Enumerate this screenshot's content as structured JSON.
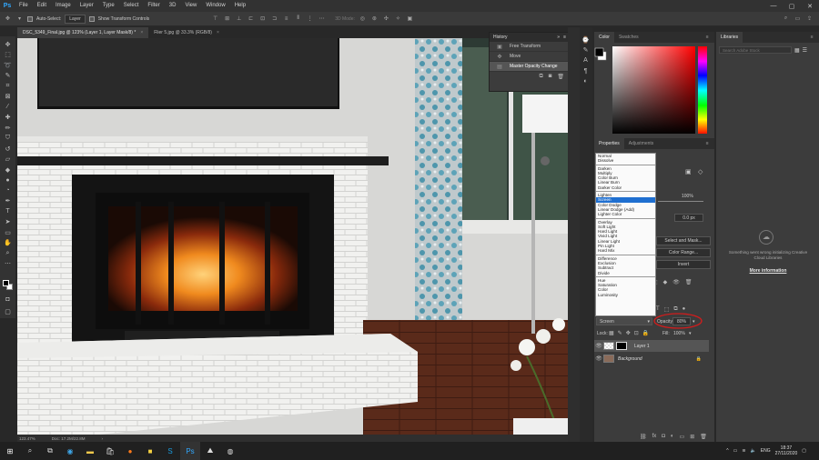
{
  "app": {
    "logo": "Ps"
  },
  "menu": [
    "File",
    "Edit",
    "Image",
    "Layer",
    "Type",
    "Select",
    "Filter",
    "3D",
    "View",
    "Window",
    "Help"
  ],
  "window_controls": [
    "—",
    "▢",
    "✕"
  ],
  "options_bar": {
    "auto_select_label": "Auto-Select:",
    "auto_select_target": "Layer",
    "show_transform_label": "Show Transform Controls",
    "mode_3d_label": "3D Mode:"
  },
  "doc_tabs": [
    {
      "label": "DSC_5349_Final.jpg @ 123% (Layer 1, Layer Mask/8) *"
    },
    {
      "label": "Flier 5.jpg @ 33.3% (RGB/8)"
    }
  ],
  "history": {
    "title": "History",
    "items": [
      {
        "icon": "move-icon",
        "label": "Free Transform"
      },
      {
        "icon": "move-icon",
        "label": "Move"
      },
      {
        "icon": "opacity-icon",
        "label": "Master Opacity Change"
      }
    ]
  },
  "color_panel": {
    "tabs": [
      "Color",
      "Swatches"
    ],
    "hue": "#ff0000"
  },
  "properties_panel": {
    "tabs": [
      "Properties",
      "Adjustments"
    ],
    "density": "100%",
    "feather": "0.0 px",
    "select_mask": "Select and Mask...",
    "color_range": "Color Range...",
    "invert": "Invert"
  },
  "blend_modes": [
    [
      "Normal",
      "Dissolve"
    ],
    [
      "Darken",
      "Multiply",
      "Color Burn",
      "Linear Burn",
      "Darker Color"
    ],
    [
      "Lighten",
      "Screen",
      "Color Dodge",
      "Linear Dodge (Add)",
      "Lighter Color"
    ],
    [
      "Overlay",
      "Soft Light",
      "Hard Light",
      "Vivid Light",
      "Linear Light",
      "Pin Light",
      "Hard Mix"
    ],
    [
      "Difference",
      "Exclusion",
      "Subtract",
      "Divide"
    ],
    [
      "Hue",
      "Saturation",
      "Color",
      "Luminosity"
    ]
  ],
  "blend_selected": "Screen",
  "layers_panel": {
    "blend_mode": "Screen",
    "opacity_label": "Opacity:",
    "opacity": "80%",
    "lock_label": "Lock:",
    "fill_label": "Fill:",
    "fill": "100%",
    "layers": [
      {
        "name": "Layer 1",
        "selected": true
      },
      {
        "name": "Background",
        "selected": false
      }
    ]
  },
  "libraries": {
    "title": "Libraries",
    "search_placeholder": "Search Adobe Stock",
    "error_message": "Something went wrong initializing Creative Cloud Libraries",
    "more_info": "More information"
  },
  "status_bar": {
    "zoom": "123.47%",
    "doc": "Doc: 17.2M/22.8M"
  },
  "taskbar": {
    "language": "ENG",
    "time": "18:37",
    "date": "27/11/2020"
  }
}
